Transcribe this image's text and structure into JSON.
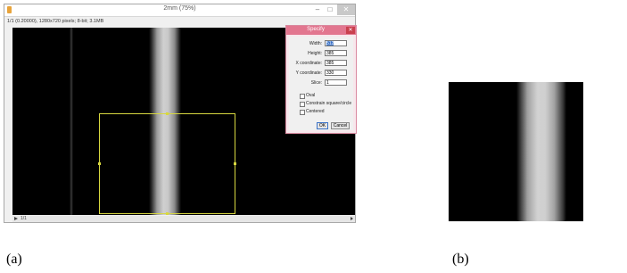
{
  "window": {
    "title": "2mm (75%)",
    "info": "1/1 (0.20000), 1280x720 pixels; 8-bit; 3.1MB",
    "min_glyph": "–",
    "max_glyph": "□",
    "close_glyph": "✕"
  },
  "stack": {
    "slice_label": "1/1"
  },
  "dialog": {
    "title": "Specify",
    "close_glyph": "✕",
    "fields": [
      {
        "label": "Width:",
        "value": "512"
      },
      {
        "label": "Height:",
        "value": "385"
      },
      {
        "label": "X coordinate:",
        "value": "385"
      },
      {
        "label": "Y coordinate:",
        "value": "330"
      },
      {
        "label": "Slice:",
        "value": "1"
      }
    ],
    "checkboxes": [
      {
        "label": "Oval",
        "checked": false
      },
      {
        "label": "Constrain square/circle",
        "checked": false
      },
      {
        "label": "Centered",
        "checked": false
      }
    ],
    "ok_label": "OK",
    "cancel_label": "Cancel"
  },
  "captions": {
    "a": "(a)",
    "b": "(b)"
  },
  "colors": {
    "dialog_title": "#e2768f",
    "selection": "#d8d840",
    "accent": "#3b73c8"
  }
}
